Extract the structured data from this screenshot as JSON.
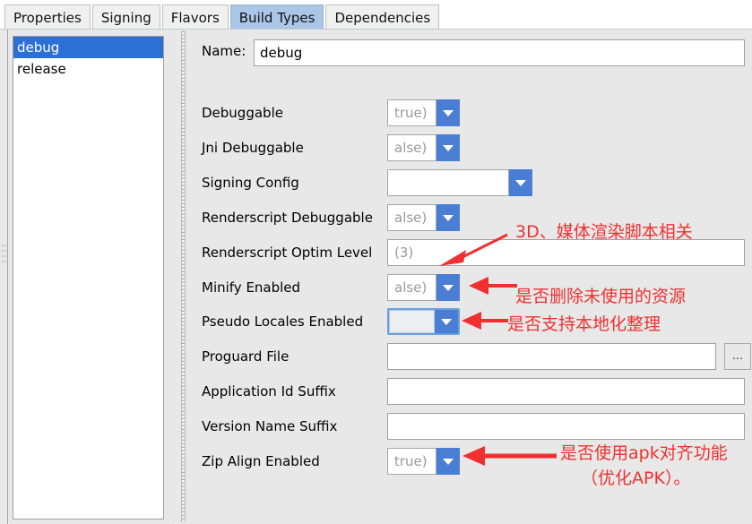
{
  "tabs": [
    {
      "label": "Properties",
      "selected": false
    },
    {
      "label": "Signing",
      "selected": false
    },
    {
      "label": "Flavors",
      "selected": false
    },
    {
      "label": "Build Types",
      "selected": true
    },
    {
      "label": "Dependencies",
      "selected": false
    }
  ],
  "sidebar": {
    "items": [
      {
        "label": "debug",
        "selected": true
      },
      {
        "label": "release",
        "selected": false
      }
    ],
    "add_button": "+",
    "remove_button": "−"
  },
  "form": {
    "name_label": "Name:",
    "name_value": "debug",
    "browse_button": "...",
    "rows": [
      {
        "label": "Debuggable",
        "type": "combo",
        "value": "true)"
      },
      {
        "label": "Jni Debuggable",
        "type": "combo",
        "value": "alse)"
      },
      {
        "label": "Signing Config",
        "type": "combo",
        "value": ""
      },
      {
        "label": "Renderscript Debuggable",
        "type": "combo",
        "value": "alse)"
      },
      {
        "label": "Renderscript Optim Level",
        "type": "textfield",
        "value": "(3)"
      },
      {
        "label": "Minify Enabled",
        "type": "combo",
        "value": "alse)"
      },
      {
        "label": "Pseudo Locales Enabled",
        "type": "combo",
        "value": ""
      },
      {
        "label": "Proguard File",
        "type": "textfield",
        "value": ""
      },
      {
        "label": "Application Id Suffix",
        "type": "textfield",
        "value": ""
      },
      {
        "label": "Version Name Suffix",
        "type": "textfield",
        "value": ""
      },
      {
        "label": "Zip Align Enabled",
        "type": "combo",
        "value": "true)"
      }
    ]
  },
  "annotations": [
    {
      "text": "3D、媒体渲染脚本相关"
    },
    {
      "text": "是否删除未使用的资源"
    },
    {
      "text": "是否支持本地化整理"
    },
    {
      "text": "是否使用apk对齐功能"
    },
    {
      "text": "（优化APK）。"
    }
  ],
  "colors": {
    "selected_tab": "#aac7e8",
    "list_selection": "#2d6fd4",
    "combo_arrow": "#4a7ed4",
    "annotation": "#f03030",
    "add_icon": "#31b24a",
    "remove_icon": "#9a9a9a",
    "panel_background": "#e8e8e8"
  }
}
